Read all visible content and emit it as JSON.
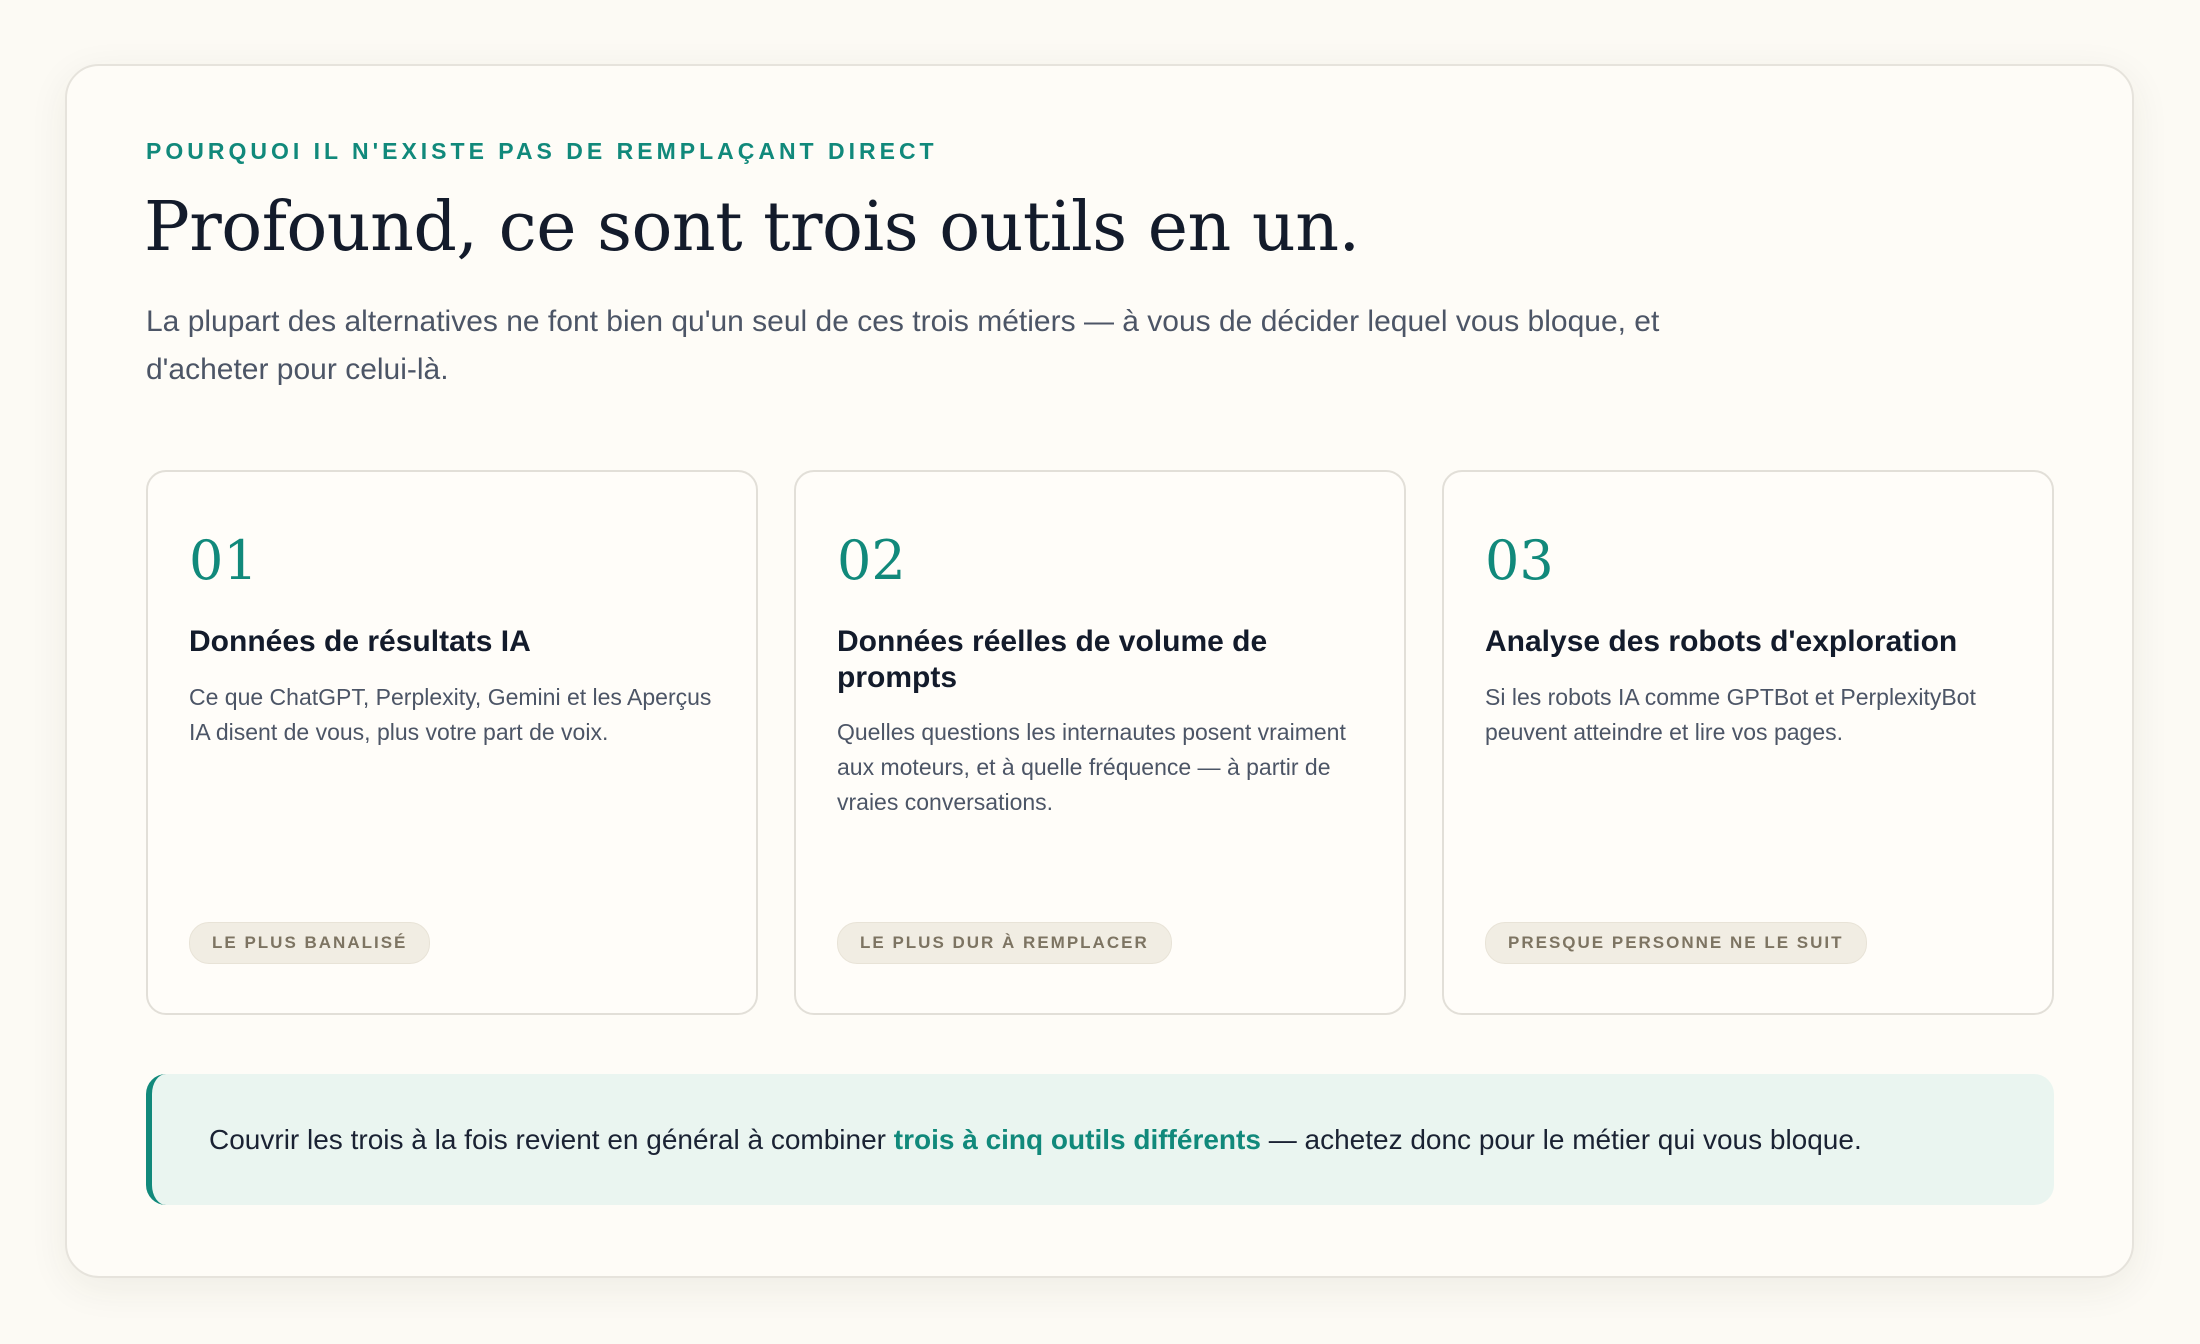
{
  "header": {
    "eyebrow": "POURQUOI IL N'EXISTE PAS DE REMPLAÇANT DIRECT",
    "title": "Profound, ce sont trois outils en un.",
    "lead": "La plupart des alternatives ne font bien qu'un seul de ces trois métiers — à vous de décider lequel vous bloque, et d'acheter pour celui-là."
  },
  "cards": [
    {
      "number": "01",
      "title": "Données de résultats IA",
      "description": "Ce que ChatGPT, Perplexity, Gemini et les Aperçus IA disent de vous, plus votre part de voix.",
      "badge": "LE PLUS BANALISÉ"
    },
    {
      "number": "02",
      "title": "Données réelles de volume de prompts",
      "description": "Quelles questions les internautes posent vraiment aux moteurs, et à quelle fréquence — à partir de vraies conversations.",
      "badge": "LE PLUS DUR À REMPLACER"
    },
    {
      "number": "03",
      "title": "Analyse des robots d'exploration",
      "description": "Si les robots IA comme GPTBot et PerplexityBot peuvent atteindre et lire vos pages.",
      "badge": "PRESQUE PERSONNE NE LE SUIT"
    }
  ],
  "callout": {
    "before": "Couvrir les trois à la fois revient en général à combiner ",
    "highlight": "trois à cinq outils différents",
    "after": " — achetez donc pour le métier qui vous bloque."
  },
  "colors": {
    "accent": "#11897b",
    "background": "#fcfaf4",
    "callout_background": "#eaf5f0",
    "badge_background": "#f1ede3"
  }
}
